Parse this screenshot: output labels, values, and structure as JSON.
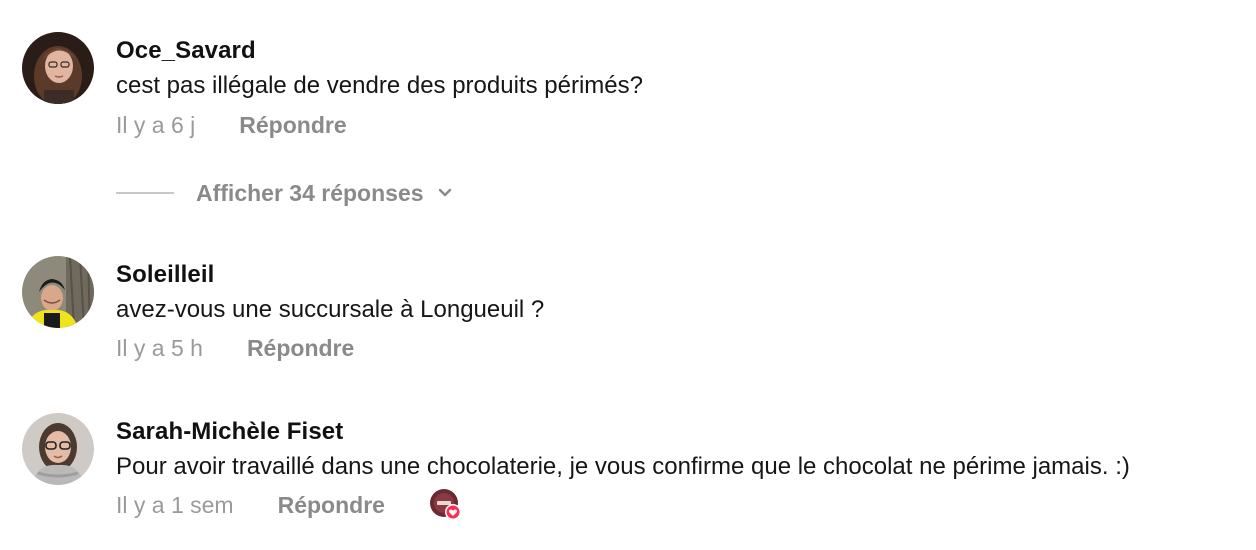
{
  "comments": [
    {
      "username": "Oce_Savard",
      "text": "cest pas illégale de vendre des produits périmés?",
      "time": "Il y a 6 j",
      "reply_label": "Répondre",
      "avatar_icon": "user-avatar-photo"
    },
    {
      "username": "Soleilleil",
      "text": "avez-vous une succursale à Longueuil ?",
      "time": "Il y a 5 h",
      "reply_label": "Répondre",
      "avatar_icon": "user-avatar-photo"
    },
    {
      "username": "Sarah-Michèle Fiset",
      "text": "Pour avoir travaillé dans une chocolaterie, je vous confirme que le chocolat ne périme jamais. :)",
      "time": "Il y a 1 sem",
      "reply_label": "Répondre",
      "avatar_icon": "user-avatar-photo",
      "creator_liked": true
    }
  ],
  "show_replies": {
    "label": "Afficher 34 réponses",
    "icon": "chevron-down-icon"
  },
  "colors": {
    "background": "#ffffff",
    "text": "#161616",
    "muted": "#9a9a9a",
    "heart": "#fe2c55"
  }
}
